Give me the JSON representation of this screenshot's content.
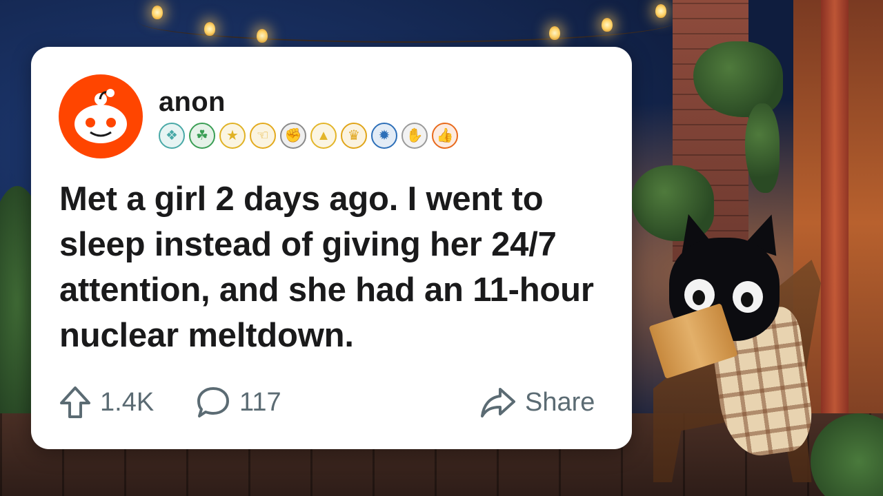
{
  "post": {
    "username": "anon",
    "text": "Met a girl 2 days ago. I went to sleep instead of giving her 24/7 attention, and she had an 11-hour nuclear meltdown.",
    "upvotes": "1.4K",
    "comments": "117",
    "share_label": "Share"
  },
  "awards": [
    {
      "icon": "cyan-badge-icon",
      "glyph": "❖",
      "color": "#49a9a7"
    },
    {
      "icon": "green-clover-icon",
      "glyph": "☘",
      "color": "#3a9e55"
    },
    {
      "icon": "gold-star-icon",
      "glyph": "★",
      "color": "#e0b225"
    },
    {
      "icon": "pointing-hand-icon",
      "glyph": "☜",
      "color": "#e3aa1e"
    },
    {
      "icon": "handshake-icon",
      "glyph": "✊",
      "color": "#8a8a8a"
    },
    {
      "icon": "gold-triangle-icon",
      "glyph": "▲",
      "color": "#e3b52a"
    },
    {
      "icon": "gold-trophy-icon",
      "glyph": "♛",
      "color": "#e0a51a"
    },
    {
      "icon": "plus-one-burst-icon",
      "glyph": "✹",
      "color": "#2d6fb8"
    },
    {
      "icon": "clapping-hands-icon",
      "glyph": "✋",
      "color": "#9a9a9a"
    },
    {
      "icon": "thumbs-up-fire-icon",
      "glyph": "👍",
      "color": "#e86a1c"
    }
  ],
  "colors": {
    "avatar": "#ff4500",
    "text": "#1a1a1b",
    "muted": "#5b6b73",
    "card": "#ffffff"
  }
}
